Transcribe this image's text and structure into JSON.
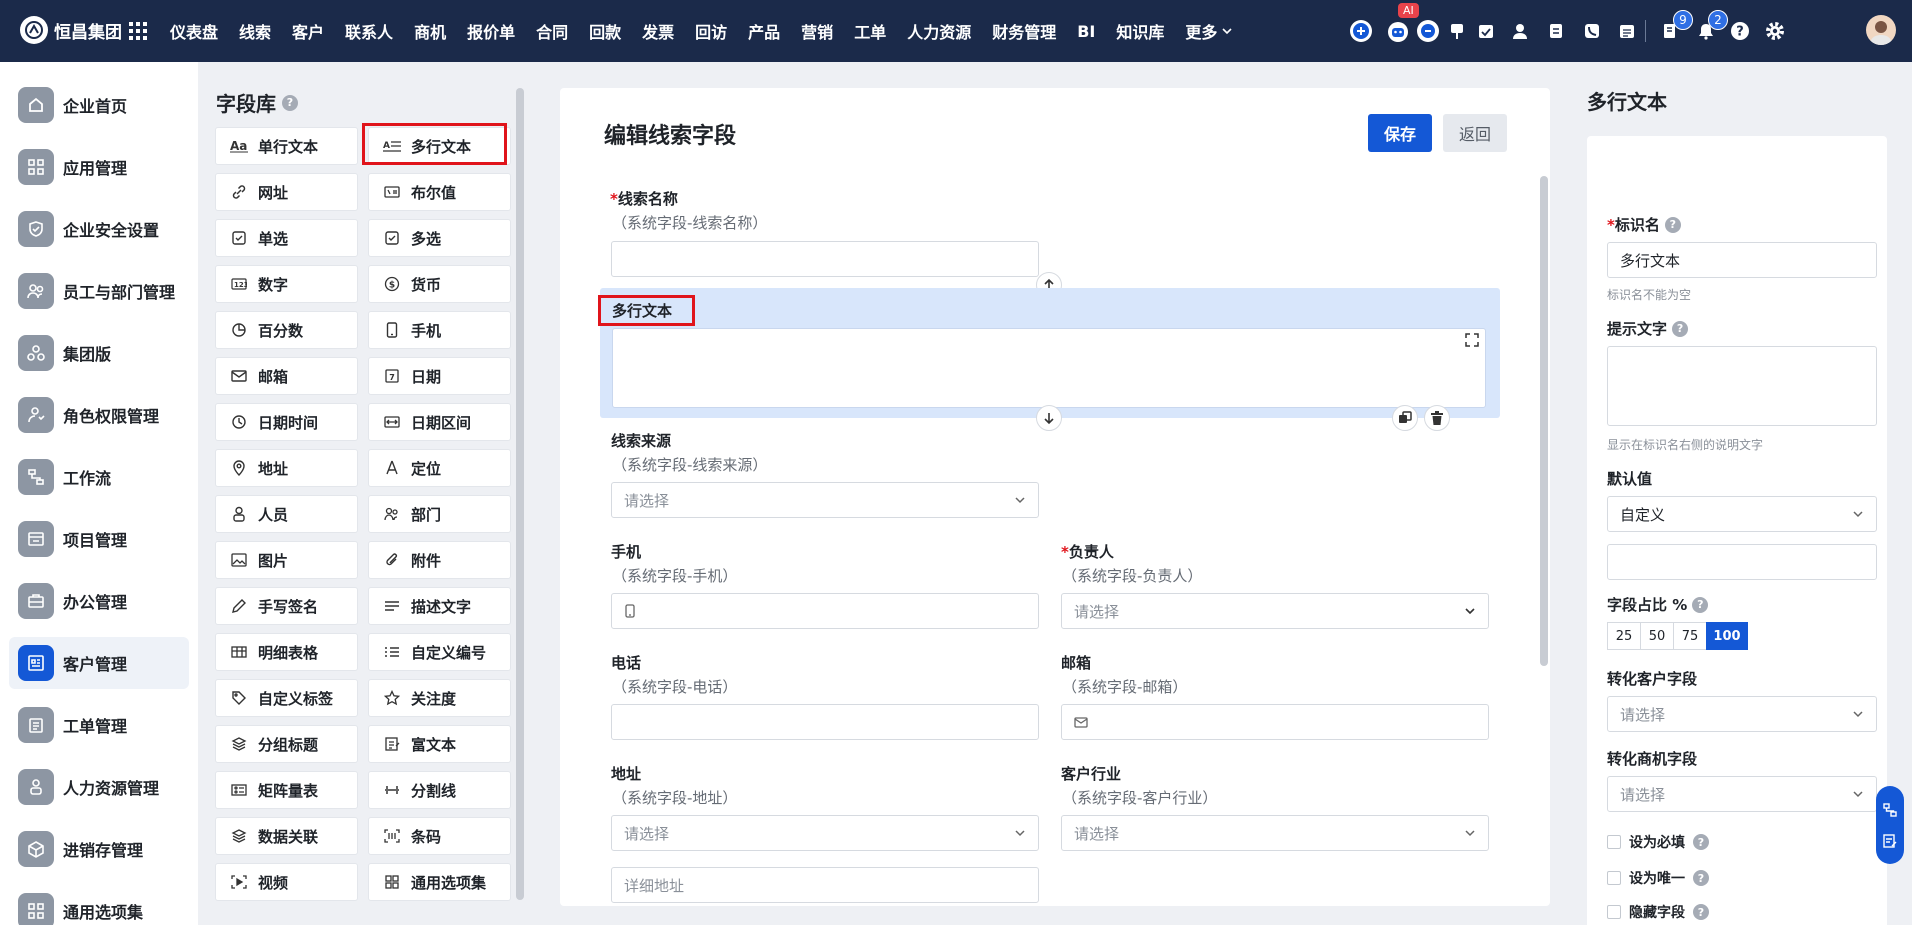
{
  "brand": {
    "name": "恒昌集团"
  },
  "nav": {
    "items": [
      "仪表盘",
      "线索",
      "客户",
      "联系人",
      "商机",
      "报价单",
      "合同",
      "回款",
      "发票",
      "回访",
      "产品",
      "营销",
      "工单",
      "人力资源",
      "财务管理",
      "BI",
      "知识库"
    ],
    "more": "更多"
  },
  "top_icons": {
    "ai_badge": "AI",
    "badge_tasks": "9",
    "badge_notify": "2"
  },
  "sidebar": {
    "items": [
      "企业首页",
      "应用管理",
      "企业安全设置",
      "员工与部门管理",
      "集团版",
      "角色权限管理",
      "工作流",
      "项目管理",
      "办公管理",
      "客户管理",
      "工单管理",
      "人力资源管理",
      "进销存管理",
      "通用选项集"
    ],
    "active": "客户管理"
  },
  "field_library": {
    "title": "字段库",
    "fields": [
      "单行文本",
      "多行文本",
      "网址",
      "布尔值",
      "单选",
      "多选",
      "数字",
      "货币",
      "百分数",
      "手机",
      "邮箱",
      "日期",
      "日期时间",
      "日期区间",
      "地址",
      "定位",
      "人员",
      "部门",
      "图片",
      "附件",
      "手写签名",
      "描述文字",
      "明细表格",
      "自定义编号",
      "自定义标签",
      "关注度",
      "分组标题",
      "富文本",
      "矩阵量表",
      "分割线",
      "数据关联",
      "条码",
      "视频",
      "通用选项集"
    ]
  },
  "editor": {
    "title": "编辑线索字段",
    "save": "保存",
    "back": "返回",
    "selected_field": "多行文本",
    "fields": {
      "name": {
        "label": "线索名称",
        "sub": "（系统字段-线索名称）"
      },
      "source": {
        "label": "线索来源",
        "sub": "（系统字段-线索来源）",
        "placeholder": "请选择"
      },
      "mobile": {
        "label": "手机",
        "sub": "（系统字段-手机）"
      },
      "owner": {
        "label": "负责人",
        "sub": "（系统字段-负责人）",
        "placeholder": "请选择"
      },
      "phone": {
        "label": "电话",
        "sub": "（系统字段-电话）"
      },
      "email": {
        "label": "邮箱",
        "sub": "（系统字段-邮箱）"
      },
      "address": {
        "label": "地址",
        "sub": "（系统字段-地址）",
        "placeholder": "请选择",
        "detail": "详细地址"
      },
      "industry": {
        "label": "客户行业",
        "sub": "（系统字段-客户行业）",
        "placeholder": "请选择"
      }
    }
  },
  "props": {
    "title": "多行文本",
    "ident_label": "标识名",
    "ident_value": "多行文本",
    "ident_hint": "标识名不能为空",
    "tip_label": "提示文字",
    "tip_hint": "显示在标识名右侧的说明文字",
    "default_label": "默认值",
    "default_value": "自定义",
    "ratio_label": "字段占比 %",
    "ratios": [
      "25",
      "50",
      "75",
      "100"
    ],
    "ratio_selected": "100",
    "convert_customer_label": "转化客户字段",
    "convert_customer_placeholder": "请选择",
    "convert_opportunity_label": "转化商机字段",
    "convert_opportunity_placeholder": "请选择",
    "required": "设为必填",
    "unique": "设为唯一",
    "hidden": "隐藏字段"
  }
}
